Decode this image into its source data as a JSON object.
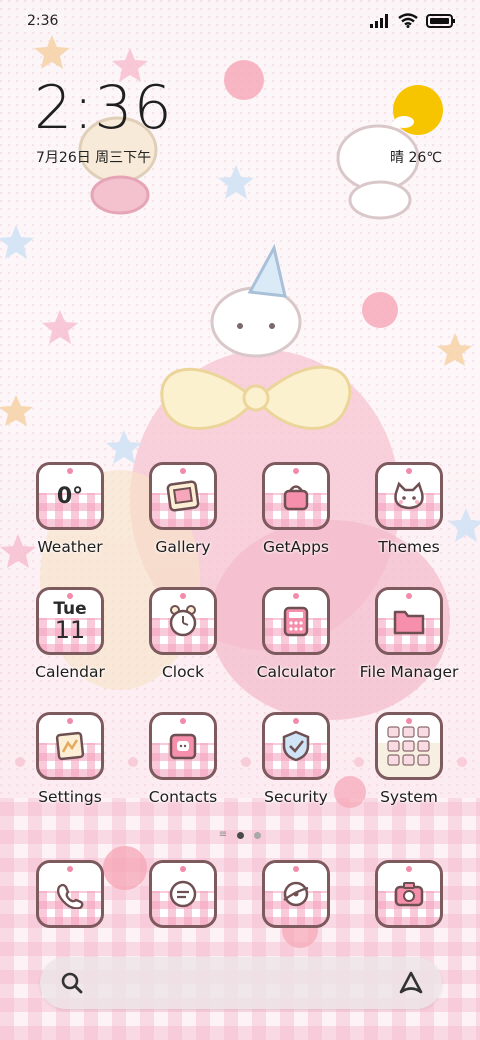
{
  "status_bar": {
    "time": "2:36"
  },
  "clock_widget": {
    "time": "2:36",
    "date": "7月26日 周三下午",
    "weather": "晴 26℃"
  },
  "apps": {
    "weather": {
      "label": "Weather",
      "value": "0°"
    },
    "gallery": {
      "label": "Gallery"
    },
    "getapps": {
      "label": "GetApps"
    },
    "themes": {
      "label": "Themes"
    },
    "calendar": {
      "label": "Calendar",
      "day": "Tue",
      "date": "11"
    },
    "clock": {
      "label": "Clock"
    },
    "calculator": {
      "label": "Calculator"
    },
    "file_manager": {
      "label": "File Manager"
    },
    "settings": {
      "label": "Settings"
    },
    "contacts": {
      "label": "Contacts"
    },
    "security": {
      "label": "Security"
    },
    "system": {
      "label": "System"
    }
  },
  "dock": [
    "phone",
    "messages",
    "browser",
    "camera"
  ],
  "page_indicator": {
    "pages": 2,
    "active": 1
  },
  "colors": {
    "accent_pink": "#f28aaa",
    "icon_border": "#7c5a5e",
    "sun": "#f7c400"
  }
}
